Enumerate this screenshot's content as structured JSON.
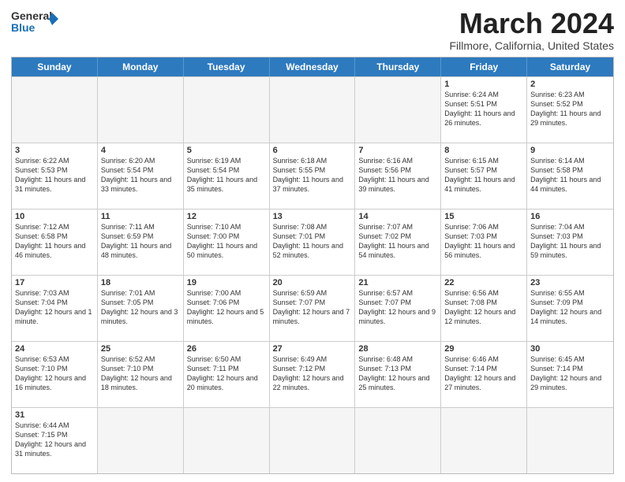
{
  "header": {
    "logo_general": "General",
    "logo_blue": "Blue",
    "title": "March 2024",
    "location": "Fillmore, California, United States"
  },
  "days_of_week": [
    "Sunday",
    "Monday",
    "Tuesday",
    "Wednesday",
    "Thursday",
    "Friday",
    "Saturday"
  ],
  "weeks": [
    [
      {
        "day": "",
        "info": ""
      },
      {
        "day": "",
        "info": ""
      },
      {
        "day": "",
        "info": ""
      },
      {
        "day": "",
        "info": ""
      },
      {
        "day": "",
        "info": ""
      },
      {
        "day": "1",
        "info": "Sunrise: 6:24 AM\nSunset: 5:51 PM\nDaylight: 11 hours and 26 minutes."
      },
      {
        "day": "2",
        "info": "Sunrise: 6:23 AM\nSunset: 5:52 PM\nDaylight: 11 hours and 29 minutes."
      }
    ],
    [
      {
        "day": "3",
        "info": "Sunrise: 6:22 AM\nSunset: 5:53 PM\nDaylight: 11 hours and 31 minutes."
      },
      {
        "day": "4",
        "info": "Sunrise: 6:20 AM\nSunset: 5:54 PM\nDaylight: 11 hours and 33 minutes."
      },
      {
        "day": "5",
        "info": "Sunrise: 6:19 AM\nSunset: 5:54 PM\nDaylight: 11 hours and 35 minutes."
      },
      {
        "day": "6",
        "info": "Sunrise: 6:18 AM\nSunset: 5:55 PM\nDaylight: 11 hours and 37 minutes."
      },
      {
        "day": "7",
        "info": "Sunrise: 6:16 AM\nSunset: 5:56 PM\nDaylight: 11 hours and 39 minutes."
      },
      {
        "day": "8",
        "info": "Sunrise: 6:15 AM\nSunset: 5:57 PM\nDaylight: 11 hours and 41 minutes."
      },
      {
        "day": "9",
        "info": "Sunrise: 6:14 AM\nSunset: 5:58 PM\nDaylight: 11 hours and 44 minutes."
      }
    ],
    [
      {
        "day": "10",
        "info": "Sunrise: 7:12 AM\nSunset: 6:58 PM\nDaylight: 11 hours and 46 minutes."
      },
      {
        "day": "11",
        "info": "Sunrise: 7:11 AM\nSunset: 6:59 PM\nDaylight: 11 hours and 48 minutes."
      },
      {
        "day": "12",
        "info": "Sunrise: 7:10 AM\nSunset: 7:00 PM\nDaylight: 11 hours and 50 minutes."
      },
      {
        "day": "13",
        "info": "Sunrise: 7:08 AM\nSunset: 7:01 PM\nDaylight: 11 hours and 52 minutes."
      },
      {
        "day": "14",
        "info": "Sunrise: 7:07 AM\nSunset: 7:02 PM\nDaylight: 11 hours and 54 minutes."
      },
      {
        "day": "15",
        "info": "Sunrise: 7:06 AM\nSunset: 7:03 PM\nDaylight: 11 hours and 56 minutes."
      },
      {
        "day": "16",
        "info": "Sunrise: 7:04 AM\nSunset: 7:03 PM\nDaylight: 11 hours and 59 minutes."
      }
    ],
    [
      {
        "day": "17",
        "info": "Sunrise: 7:03 AM\nSunset: 7:04 PM\nDaylight: 12 hours and 1 minute."
      },
      {
        "day": "18",
        "info": "Sunrise: 7:01 AM\nSunset: 7:05 PM\nDaylight: 12 hours and 3 minutes."
      },
      {
        "day": "19",
        "info": "Sunrise: 7:00 AM\nSunset: 7:06 PM\nDaylight: 12 hours and 5 minutes."
      },
      {
        "day": "20",
        "info": "Sunrise: 6:59 AM\nSunset: 7:07 PM\nDaylight: 12 hours and 7 minutes."
      },
      {
        "day": "21",
        "info": "Sunrise: 6:57 AM\nSunset: 7:07 PM\nDaylight: 12 hours and 9 minutes."
      },
      {
        "day": "22",
        "info": "Sunrise: 6:56 AM\nSunset: 7:08 PM\nDaylight: 12 hours and 12 minutes."
      },
      {
        "day": "23",
        "info": "Sunrise: 6:55 AM\nSunset: 7:09 PM\nDaylight: 12 hours and 14 minutes."
      }
    ],
    [
      {
        "day": "24",
        "info": "Sunrise: 6:53 AM\nSunset: 7:10 PM\nDaylight: 12 hours and 16 minutes."
      },
      {
        "day": "25",
        "info": "Sunrise: 6:52 AM\nSunset: 7:10 PM\nDaylight: 12 hours and 18 minutes."
      },
      {
        "day": "26",
        "info": "Sunrise: 6:50 AM\nSunset: 7:11 PM\nDaylight: 12 hours and 20 minutes."
      },
      {
        "day": "27",
        "info": "Sunrise: 6:49 AM\nSunset: 7:12 PM\nDaylight: 12 hours and 22 minutes."
      },
      {
        "day": "28",
        "info": "Sunrise: 6:48 AM\nSunset: 7:13 PM\nDaylight: 12 hours and 25 minutes."
      },
      {
        "day": "29",
        "info": "Sunrise: 6:46 AM\nSunset: 7:14 PM\nDaylight: 12 hours and 27 minutes."
      },
      {
        "day": "30",
        "info": "Sunrise: 6:45 AM\nSunset: 7:14 PM\nDaylight: 12 hours and 29 minutes."
      }
    ],
    [
      {
        "day": "31",
        "info": "Sunrise: 6:44 AM\nSunset: 7:15 PM\nDaylight: 12 hours and 31 minutes."
      },
      {
        "day": "",
        "info": ""
      },
      {
        "day": "",
        "info": ""
      },
      {
        "day": "",
        "info": ""
      },
      {
        "day": "",
        "info": ""
      },
      {
        "day": "",
        "info": ""
      },
      {
        "day": "",
        "info": ""
      }
    ]
  ]
}
